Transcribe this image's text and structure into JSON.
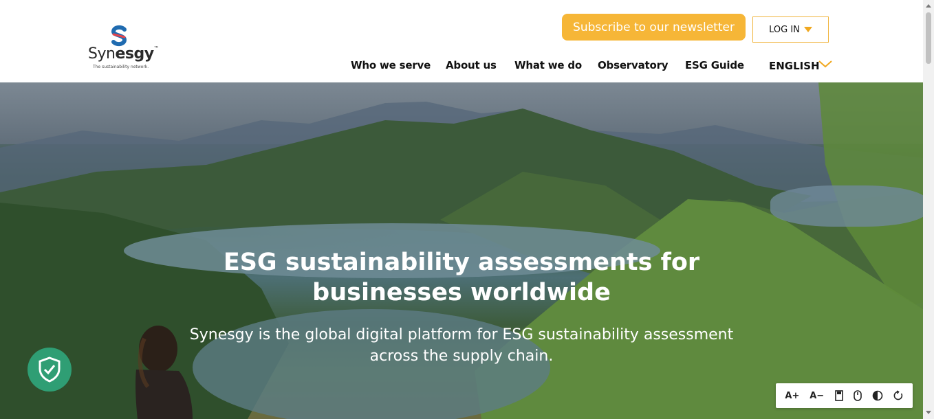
{
  "brand": {
    "name_prefix": "Syn",
    "name_bold": "esgy",
    "trademark": "™",
    "tagline": "The sustainability network.",
    "colors": {
      "mark_blue": "#1f6bb0",
      "mark_red": "#e4434b"
    }
  },
  "header": {
    "newsletter_label": "Subscribe to our newsletter",
    "login_label": "LOG IN",
    "nav": [
      "Who we serve",
      "About us",
      "What we do",
      "Observatory",
      "ESG Guide"
    ],
    "language": "ENGLISH"
  },
  "hero": {
    "title_line1": "ESG sustainability assessments for",
    "title_line2": "businesses worldwide",
    "subtitle_line1": "Synesgy is the global digital platform for ESG sustainability assessment",
    "subtitle_line2": "across the supply chain."
  },
  "accessibility_toolbar": {
    "increase_text": "A+",
    "decrease_text": "A−",
    "tools": [
      "readable-font-icon",
      "cursor-icon",
      "contrast-icon",
      "reset-icon"
    ]
  },
  "colors": {
    "accent": "#f6b637",
    "shield_green": "#2f9e74"
  }
}
